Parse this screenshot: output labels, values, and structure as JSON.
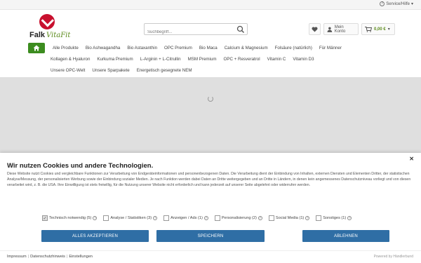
{
  "topbar": {
    "service_label": "Service/Hilfe"
  },
  "logo": {
    "brand": "Falk",
    "suffix": "VitaFit"
  },
  "search": {
    "placeholder": "Suchbegriff..."
  },
  "header": {
    "account_label": "Mein Konto",
    "cart_total": "0,00 €"
  },
  "nav": {
    "row1": [
      "Alle Produkte",
      "Bio Ashwagandha",
      "Bio Astaxanthin",
      "OPC Premium",
      "Bio Maca",
      "Calcium & Magnesium",
      "Folsäure (natürlich)",
      "Für Männer"
    ],
    "row2": [
      "Kollagen & Hyaluron",
      "Kurkuma Premium",
      "L-Arginin + L-Citrullin",
      "MSM Premium",
      "OPC + Resveratrol",
      "Vitamin C",
      "Vitamin D3"
    ],
    "row3": [
      "Unsere OPC-Welt",
      "Unsere Sparpakete",
      "Energetisch gesegnete NEM"
    ]
  },
  "cookie": {
    "title": "Wir nutzen Cookies und andere Technologien.",
    "text": "Diese Website nutzt Cookies und vergleichbare Funktionen zur Verarbeitung von Endgeräteinformationen und personenbezogenen Daten. Die Verarbeitung dient der Einbindung von Inhalten, externen Diensten und Elementen Dritter, der statistischen Analyse/Messung, der personalisierten Werbung sowie der Einbindung sozialer Medien. Je nach Funktion werden dabei Daten an Dritte weitergegeben und an Dritte in Ländern, in denen kein angemessenes Datenschutzniveau vorliegt und von diesen verarbeitet wird, z. B. die USA. Ihre Einwilligung ist stets freiwillig, für die Nutzung unserer Website nicht erforderlich und kann jederzeit auf unserer Seite abgelehnt oder widerrufen werden.",
    "checkboxes": [
      {
        "label": "Technisch notwendig (5)",
        "checked": true
      },
      {
        "label": "Analyse / Statistiken (3)",
        "checked": false
      },
      {
        "label": "Anzeigen / Ads (1)",
        "checked": false
      },
      {
        "label": "Personalisierung (2)",
        "checked": false
      },
      {
        "label": "Social Media (1)",
        "checked": false
      },
      {
        "label": "Sonstiges (1)",
        "checked": false
      }
    ],
    "accept_all": "ALLES AKZEPTIEREN",
    "save": "SPEICHERN",
    "reject": "ABLEHNEN",
    "accent_color": "#2f6ea5"
  },
  "footer": {
    "links": [
      "Impressum",
      "Datenschutzhinweis",
      "Einstellungen"
    ],
    "powered": "Powered by Händlerbund"
  }
}
